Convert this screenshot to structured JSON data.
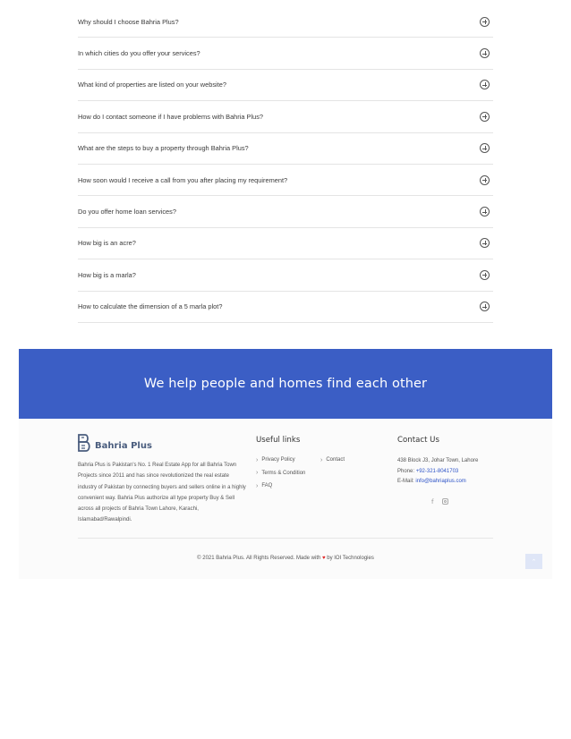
{
  "faq": [
    "Why should I choose Bahria Plus?",
    "In which cities do you offer your services?",
    "What kind of properties are listed on your website?",
    "How do I contact someone if I have problems with Bahria Plus?",
    "What are the steps to buy a property through Bahria Plus?",
    "How soon would I receive a call from you after placing my requirement?",
    "Do you offer home loan services?",
    "How big is an acre?",
    "How big is a marla?",
    "How to calculate the dimension of a 5 marla plot?"
  ],
  "banner": {
    "text": "We help people and homes find each other",
    "color": "#3b5ec5"
  },
  "footer": {
    "logo_text": "Bahria Plus",
    "about": "Bahria Plus is Pakistan's No. 1 Real Estate App for all Bahria Town Projects since 2011 and has since revolutionized the real estate industry of Pakistan by connecting buyers and sellers online in a highly convenient way. Bahria Plus authorize all type property Buy & Sell across all projects of Bahria Town Lahore, Karachi, Islamabad/Rawalpindi.",
    "useful_links_title": "Useful links",
    "links_col1": [
      "Privacy Policy",
      "Terms & Condition",
      "FAQ"
    ],
    "links_col2": [
      "Contact"
    ],
    "contact_title": "Contact Us",
    "address": "438 Block J3, Johar Town, Lahore",
    "phone_label": "Phone:",
    "phone": "+92-321-8041703",
    "email_label": "E-Mail:",
    "email": "info@bahriaplus.com",
    "social": [
      "facebook-icon",
      "instagram-icon"
    ],
    "copyright_pre": "© 2021 Bahria Plus. All Rights Reserved. Made with",
    "copyright_post": "by IOI Technologies",
    "accent": "#2d53c7"
  }
}
